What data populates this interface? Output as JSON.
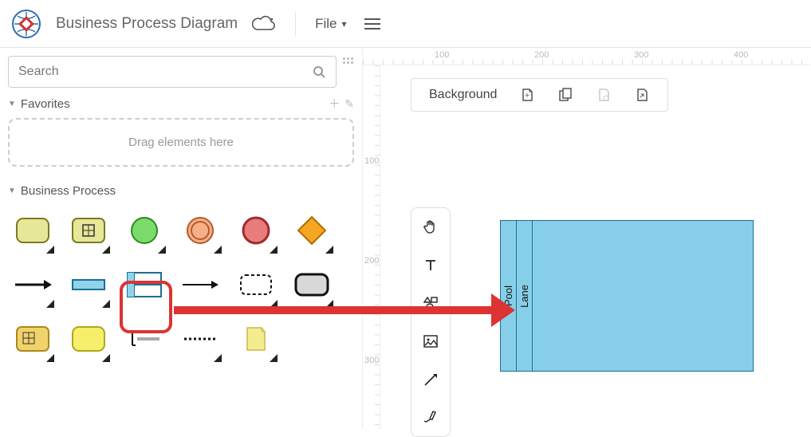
{
  "header": {
    "title": "Business Process Diagram",
    "file_label": "File"
  },
  "sidebar": {
    "search_placeholder": "Search",
    "favorites_label": "Favorites",
    "dropzone_label": "Drag elements here",
    "business_process_label": "Business Process",
    "shape_names": {
      "task": "task-shape",
      "task_grid": "task-grid-shape",
      "start_event": "start-event-shape",
      "intermediate_event": "intermediate-event-shape",
      "end_event": "end-event-shape",
      "gateway": "gateway-shape",
      "sequence_flow": "sequence-flow-shape",
      "data_object": "data-object-shape",
      "pool": "pool-shape",
      "lane": "lane-shape",
      "group_boundary": "group-boundary-shape",
      "call_activity": "call-activity-shape",
      "data_store_alt": "data-store-alt-shape",
      "expanded_task": "expanded-task-shape",
      "annotation_line": "annotation-line-shape",
      "message": "message-shape",
      "text_annotation": "text-annotation-shape"
    }
  },
  "canvas": {
    "background_label": "Background",
    "ruler_top": {
      "t1": "100",
      "t2": "200",
      "t3": "300",
      "t4": "400"
    },
    "ruler_left": {
      "l1": "100",
      "l2": "200",
      "l3": "300"
    },
    "pool_label": "Pool",
    "lane_label": "Lane"
  },
  "highlight": {
    "target_shape": "pool-shape",
    "color": "#d33"
  }
}
